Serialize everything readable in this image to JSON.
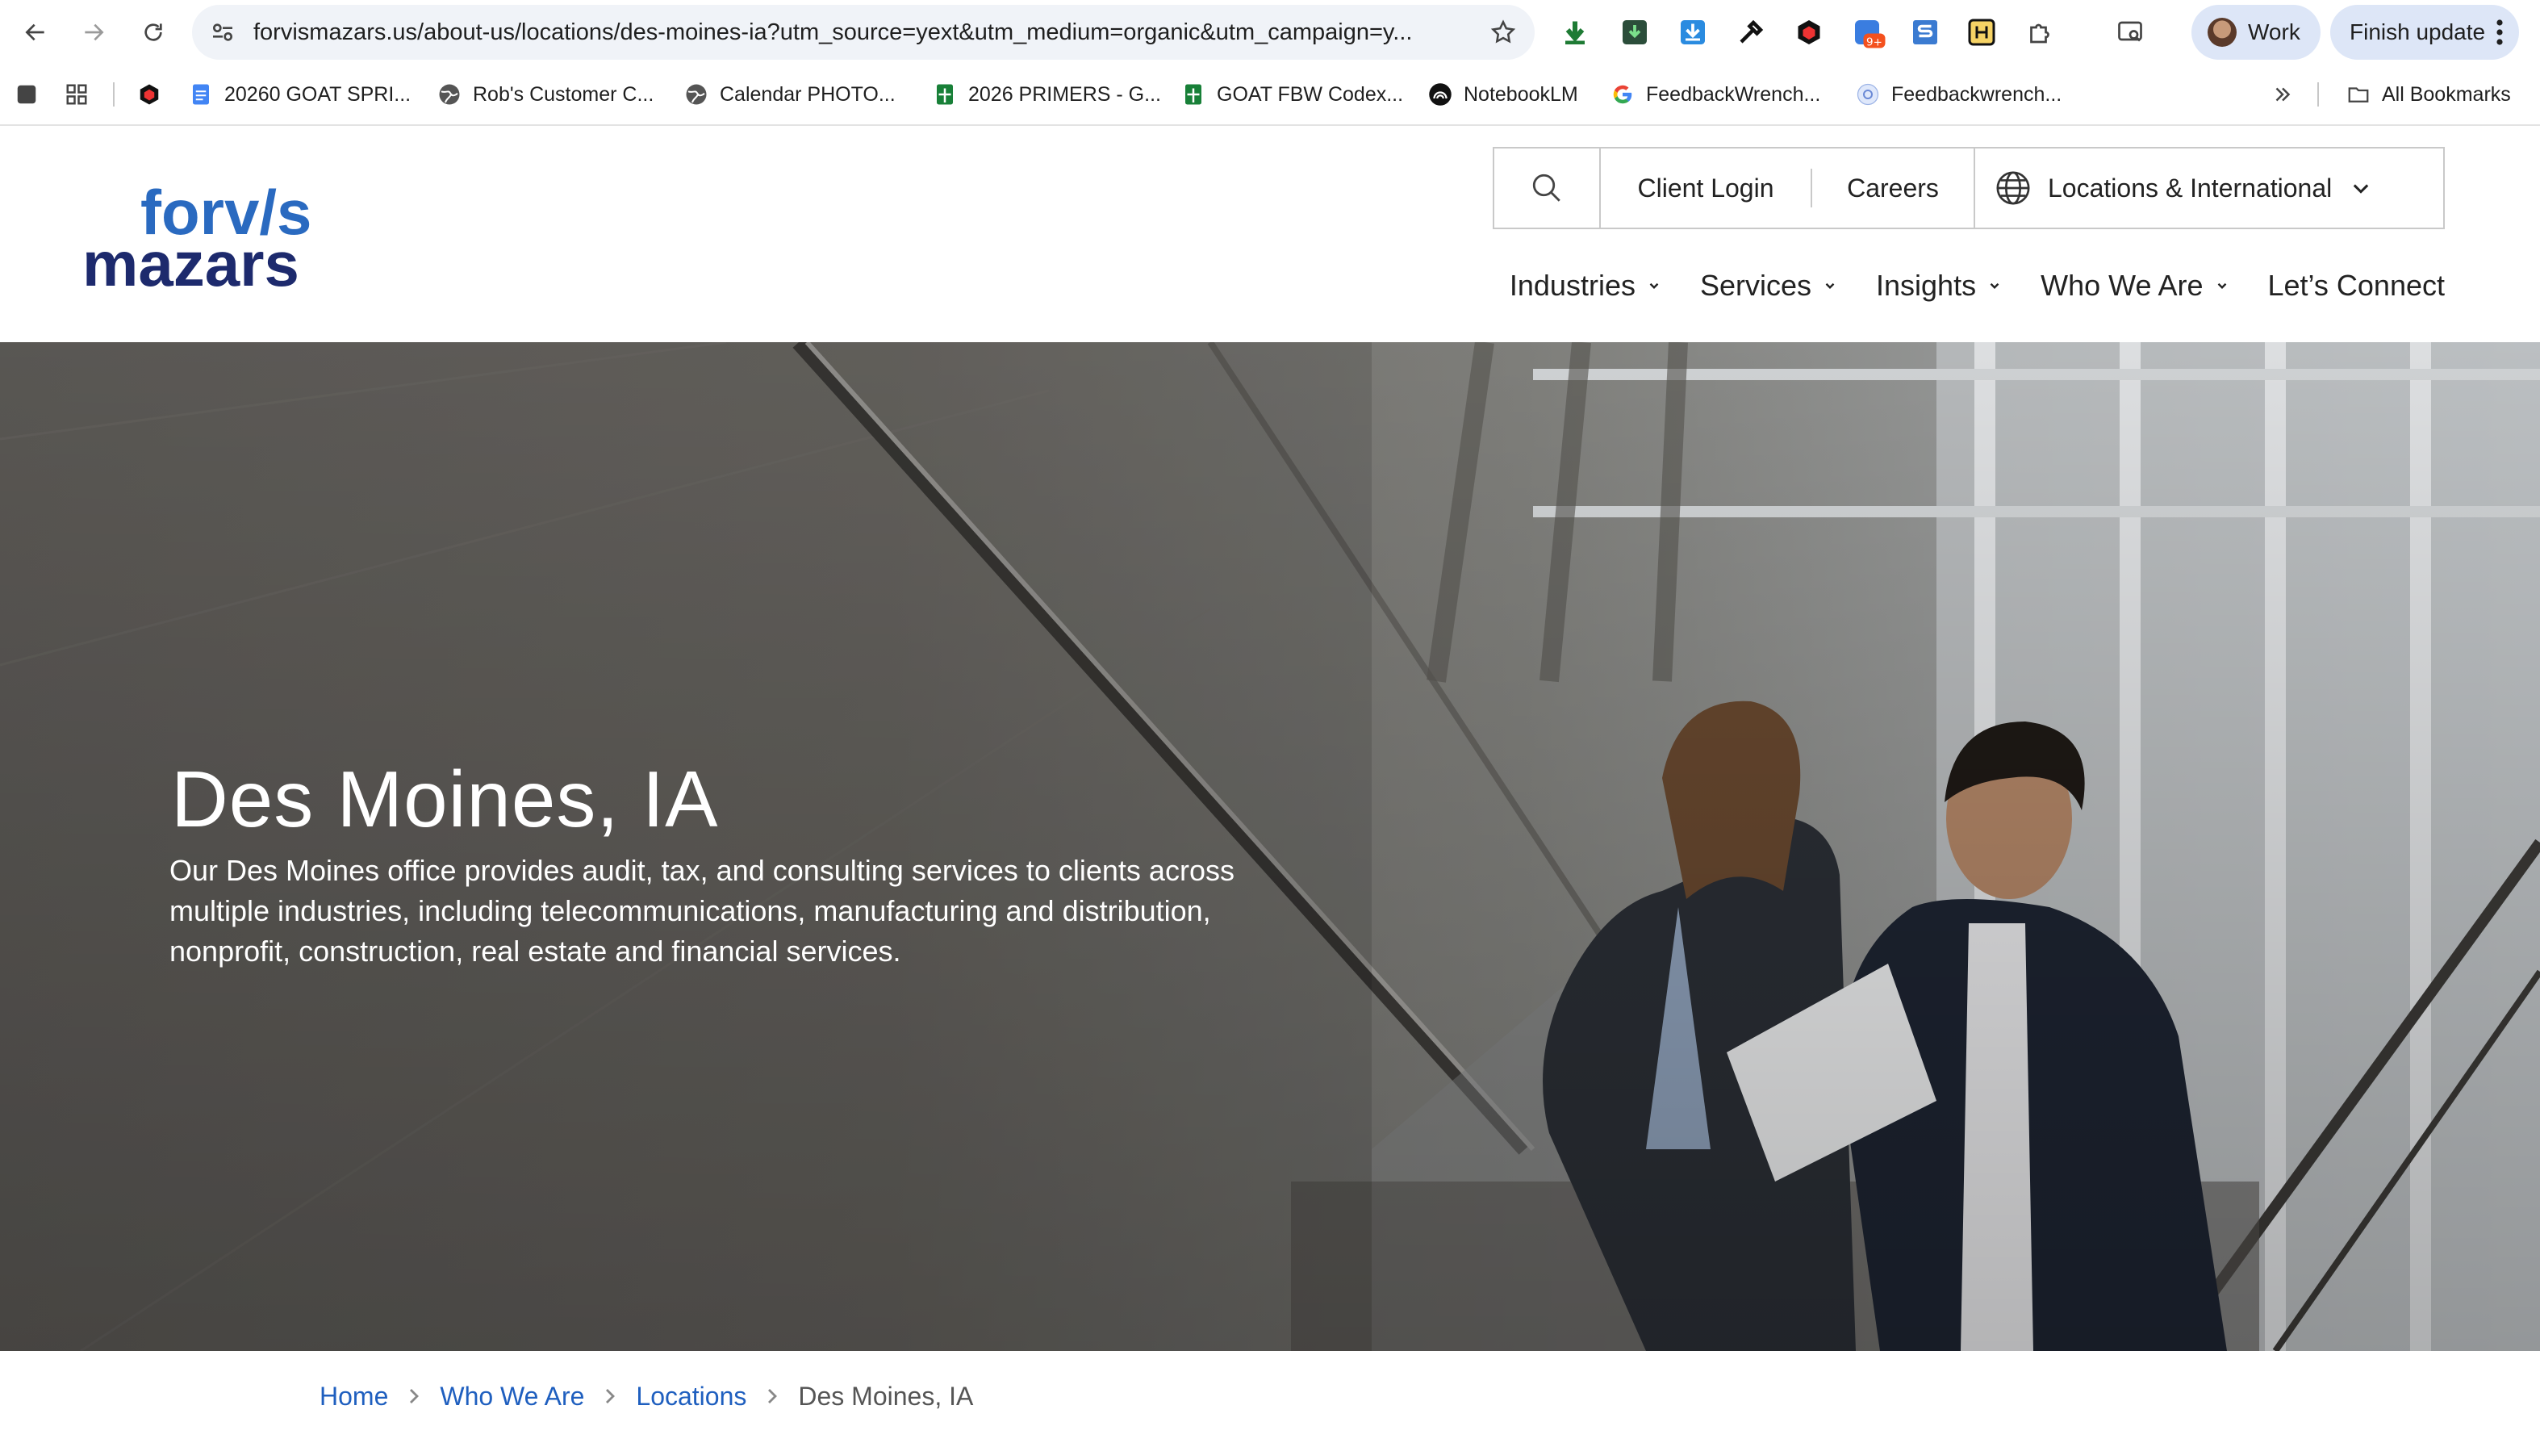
{
  "browser": {
    "url": "forvismazars.us/about-us/locations/des-moines-ia?utm_source=yext&utm_medium=organic&utm_campaign=y...",
    "profile_label": "Work",
    "update_label": "Finish update",
    "badge": "9+",
    "bookmarks": [
      {
        "label": "20260 GOAT SPRI...",
        "icon": "docs-icon"
      },
      {
        "label": "Rob's Customer C...",
        "icon": "globe-icon"
      },
      {
        "label": "Calendar PHOTO...",
        "icon": "globe-icon"
      },
      {
        "label": "2026 PRIMERS - G...",
        "icon": "sheets-icon"
      },
      {
        "label": "GOAT FBW Codex...",
        "icon": "sheets-icon"
      },
      {
        "label": "NotebookLM",
        "icon": "notebooklm-icon"
      },
      {
        "label": "FeedbackWrench...",
        "icon": "google-icon"
      },
      {
        "label": "Feedbackwrench...",
        "icon": "feedbackwrench-icon"
      }
    ],
    "all_bookmarks": "All Bookmarks"
  },
  "site": {
    "logo_line1": "forv/s",
    "logo_line2": "mazars",
    "utility": {
      "client_login": "Client Login",
      "careers": "Careers",
      "locations": "Locations & International"
    },
    "nav": [
      {
        "label": "Industries",
        "has_menu": true
      },
      {
        "label": "Services",
        "has_menu": true
      },
      {
        "label": "Insights",
        "has_menu": true
      },
      {
        "label": "Who We Are",
        "has_menu": true
      },
      {
        "label": "Let’s Connect",
        "has_menu": false
      }
    ]
  },
  "hero": {
    "title": "Des Moines, IA",
    "description": "Our Des Moines office provides audit, tax, and consulting services to clients across multiple industries, including telecommunications, manufacturing and distribution, nonprofit, construction, real estate and financial services."
  },
  "breadcrumb": {
    "items": [
      "Home",
      "Who We Are",
      "Locations"
    ],
    "current": "Des Moines, IA"
  },
  "colors": {
    "brand_blue": "#2a6ac0",
    "brand_navy": "#1d2a6d",
    "link_blue": "#1f5fbf"
  }
}
